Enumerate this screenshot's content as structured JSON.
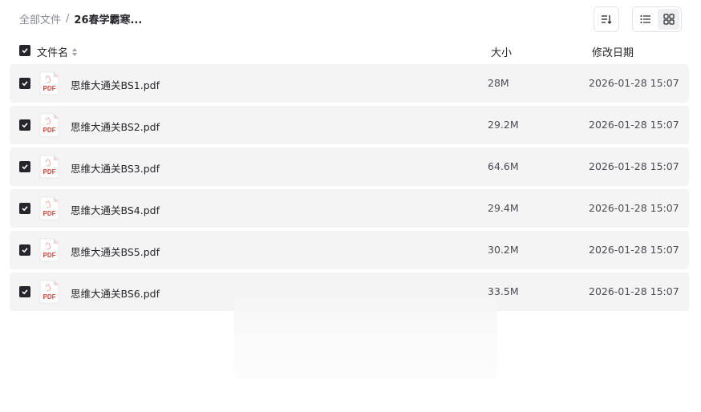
{
  "breadcrumb": {
    "root": "全部文件",
    "separator": "/",
    "current": "26春学霸寒..."
  },
  "toolbar": {
    "sort_icon": "sort-list-icon",
    "views": [
      {
        "name": "list",
        "icon": "list-view-icon",
        "active": false
      },
      {
        "name": "grid",
        "icon": "grid-view-icon",
        "active": true
      }
    ]
  },
  "columns": {
    "name": "文件名",
    "size": "大小",
    "date": "修改日期"
  },
  "files": [
    {
      "name": "思维大通关BS1.pdf",
      "size": "28M",
      "date": "2026-01-28 15:07",
      "checked": true,
      "icon": "pdf-file-icon",
      "icon_label": "PDF"
    },
    {
      "name": "思维大通关BS2.pdf",
      "size": "29.2M",
      "date": "2026-01-28 15:07",
      "checked": true,
      "icon": "pdf-file-icon",
      "icon_label": "PDF"
    },
    {
      "name": "思维大通关BS3.pdf",
      "size": "64.6M",
      "date": "2026-01-28 15:07",
      "checked": true,
      "icon": "pdf-file-icon",
      "icon_label": "PDF"
    },
    {
      "name": "思维大通关BS4.pdf",
      "size": "29.4M",
      "date": "2026-01-28 15:07",
      "checked": true,
      "icon": "pdf-file-icon",
      "icon_label": "PDF"
    },
    {
      "name": "思维大通关BS5.pdf",
      "size": "30.2M",
      "date": "2026-01-28 15:07",
      "checked": true,
      "icon": "pdf-file-icon",
      "icon_label": "PDF"
    },
    {
      "name": "思维大通关BS6.pdf",
      "size": "33.5M",
      "date": "2026-01-28 15:07",
      "checked": true,
      "icon": "pdf-file-icon",
      "icon_label": "PDF"
    }
  ],
  "colors": {
    "accent_dark": "#25262b",
    "row_bg": "#f4f4f5",
    "pdf_red": "#e5403a"
  }
}
